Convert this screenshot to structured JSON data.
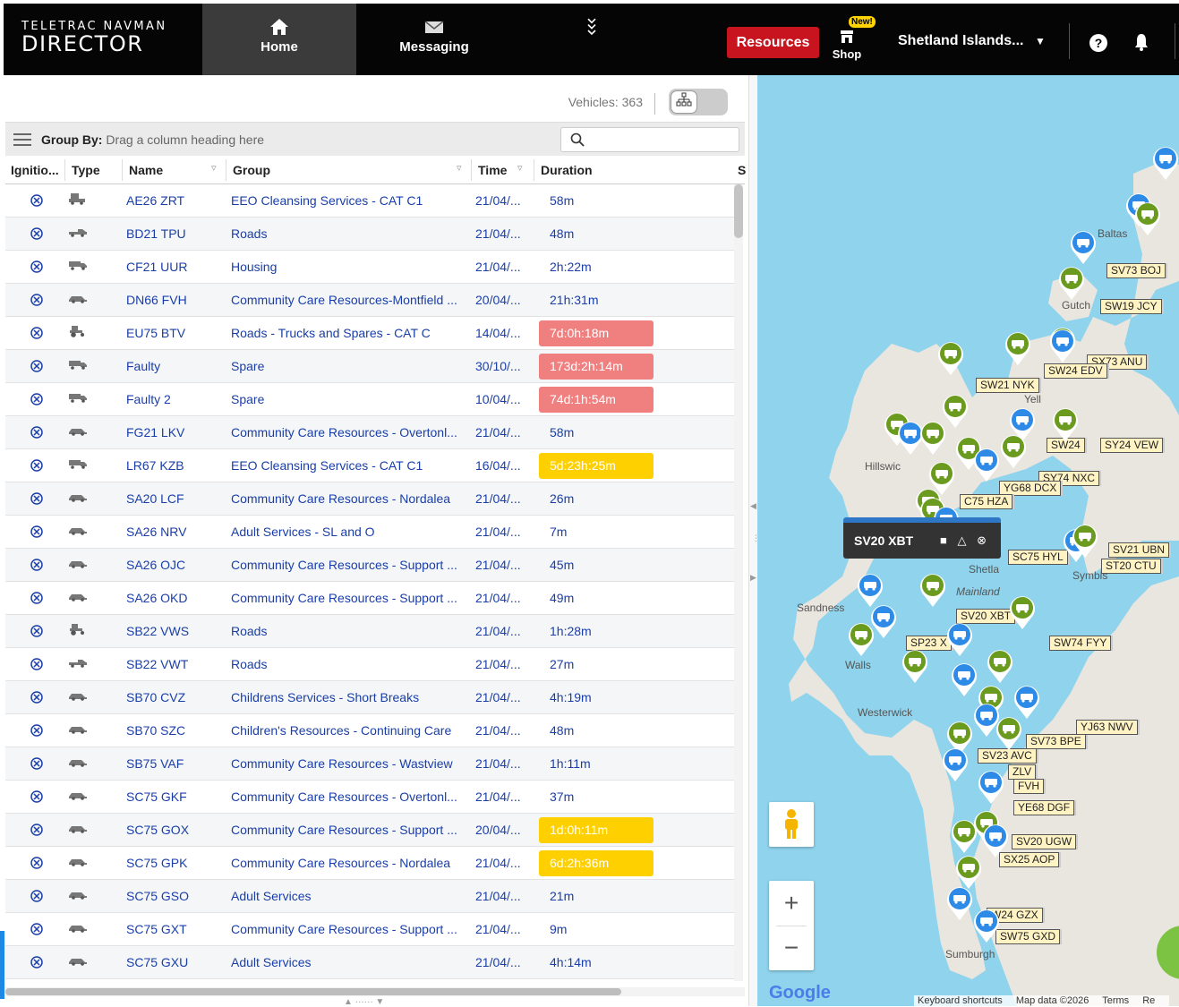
{
  "header": {
    "logo_line1": "TELETRAC NAVMAN",
    "logo_line2": "DIRECTOR",
    "nav_home": "Home",
    "nav_messaging": "Messaging",
    "resources_label": "Resources",
    "shop_badge": "New!",
    "shop_label": "Shop",
    "org_name": "Shetland Islands...",
    "accent": "#c8141e"
  },
  "toolbar": {
    "vehicles_count": "Vehicles: 363",
    "group_by_label": "Group By:",
    "group_by_hint": "Drag a column heading here"
  },
  "table": {
    "columns": [
      "Ignitio...",
      "Type",
      "Name",
      "Group",
      "Time",
      "Duration",
      "S"
    ],
    "rows": [
      {
        "name": "AE26 ZRT",
        "group": "EEO Cleansing Services - CAT C1",
        "time": "21/04/...",
        "duration": "58m",
        "dur_status": "normal",
        "type_icon": "sweeper-icon"
      },
      {
        "name": "BD21 TPU",
        "group": "Roads",
        "time": "21/04/...",
        "duration": "48m",
        "dur_status": "normal",
        "type_icon": "pickup-icon"
      },
      {
        "name": "CF21 UUR",
        "group": "Housing",
        "time": "21/04/...",
        "duration": "2h:22m",
        "dur_status": "normal",
        "type_icon": "truck-icon"
      },
      {
        "name": "DN66 FVH",
        "group": "Community Care Resources-Montfield ...",
        "time": "20/04/...",
        "duration": "21h:31m",
        "dur_status": "normal",
        "type_icon": "car-icon"
      },
      {
        "name": "EU75 BTV",
        "group": "Roads - Trucks and Spares - CAT C",
        "time": "14/04/...",
        "duration": "7d:0h:18m",
        "dur_status": "red",
        "type_icon": "tractor-icon"
      },
      {
        "name": "Faulty",
        "group": "Spare",
        "time": "30/10/...",
        "duration": "173d:2h:14m",
        "dur_status": "red",
        "type_icon": "truck-icon"
      },
      {
        "name": "Faulty 2",
        "group": "Spare",
        "time": "10/04/...",
        "duration": "74d:1h:54m",
        "dur_status": "red",
        "type_icon": "truck-icon"
      },
      {
        "name": "FG21 LKV",
        "group": "Community Care Resources - Overtonl...",
        "time": "21/04/...",
        "duration": "58m",
        "dur_status": "normal",
        "type_icon": "car-icon"
      },
      {
        "name": "LR67 KZB",
        "group": "EEO Cleansing Services - CAT C1",
        "time": "16/04/...",
        "duration": "5d:23h:25m",
        "dur_status": "yellow",
        "type_icon": "truck-icon"
      },
      {
        "name": "SA20 LCF",
        "group": "Community Care Resources - Nordalea",
        "time": "21/04/...",
        "duration": "26m",
        "dur_status": "normal",
        "type_icon": "car-icon"
      },
      {
        "name": "SA26 NRV",
        "group": "Adult Services - SL and O",
        "time": "21/04/...",
        "duration": "7m",
        "dur_status": "normal",
        "type_icon": "car-icon"
      },
      {
        "name": "SA26 OJC",
        "group": "Community Care Resources - Support ...",
        "time": "21/04/...",
        "duration": "45m",
        "dur_status": "normal",
        "type_icon": "car-icon"
      },
      {
        "name": "SA26 OKD",
        "group": "Community Care Resources - Support ...",
        "time": "21/04/...",
        "duration": "49m",
        "dur_status": "normal",
        "type_icon": "car-icon"
      },
      {
        "name": "SB22 VWS",
        "group": "Roads",
        "time": "21/04/...",
        "duration": "1h:28m",
        "dur_status": "normal",
        "type_icon": "tractor-icon"
      },
      {
        "name": "SB22 VWT",
        "group": "Roads",
        "time": "21/04/...",
        "duration": "27m",
        "dur_status": "normal",
        "type_icon": "pickup-icon"
      },
      {
        "name": "SB70 CVZ",
        "group": "Childrens Services - Short Breaks",
        "time": "21/04/...",
        "duration": "4h:19m",
        "dur_status": "normal",
        "type_icon": "car-icon"
      },
      {
        "name": "SB70 SZC",
        "group": "Children's Resources - Continuing Care",
        "time": "21/04/...",
        "duration": "48m",
        "dur_status": "normal",
        "type_icon": "car-icon"
      },
      {
        "name": "SB75 VAF",
        "group": "Community Care Resources - Wastview",
        "time": "21/04/...",
        "duration": "1h:11m",
        "dur_status": "normal",
        "type_icon": "car-icon"
      },
      {
        "name": "SC75 GKF",
        "group": "Community Care Resources - Overtonl...",
        "time": "21/04/...",
        "duration": "37m",
        "dur_status": "normal",
        "type_icon": "car-icon"
      },
      {
        "name": "SC75 GOX",
        "group": "Community Care Resources - Support ...",
        "time": "20/04/...",
        "duration": "1d:0h:11m",
        "dur_status": "yellow",
        "type_icon": "car-icon"
      },
      {
        "name": "SC75 GPK",
        "group": "Community Care Resources - Nordalea",
        "time": "21/04/...",
        "duration": "6d:2h:36m",
        "dur_status": "yellow",
        "type_icon": "car-icon"
      },
      {
        "name": "SC75 GSO",
        "group": "Adult Services",
        "time": "21/04/...",
        "duration": "21m",
        "dur_status": "normal",
        "type_icon": "car-icon"
      },
      {
        "name": "SC75 GXT",
        "group": "Community Care Resources - Support ...",
        "time": "21/04/...",
        "duration": "9m",
        "dur_status": "normal",
        "type_icon": "car-icon"
      },
      {
        "name": "SC75 GXU",
        "group": "Adult Services",
        "time": "21/04/...",
        "duration": "4h:14m",
        "dur_status": "normal",
        "type_icon": "car-icon"
      }
    ]
  },
  "map": {
    "popup_title": "SV20 XBT",
    "places": [
      "Baltas",
      "Gutch",
      "Yell",
      "Hillswic",
      "Shetla",
      "Mainland",
      "Sandness",
      "Walls",
      "Westerwick",
      "Sumburgh",
      "Symbis"
    ],
    "labels": [
      "SV73 BOJ",
      "SW19 JCY",
      "SX73 ANU",
      "SW24 EDV",
      "SW21 NYK",
      "SY24 VEW",
      "SW24",
      "SY74 NXC",
      "YG68 DCX",
      "C75 HZA",
      "SV21 UBN",
      "ST20 CTU",
      "SC75 HYL",
      "SV20 XBT",
      "SP23 X",
      "SW74 FYY",
      "SV23 AVC",
      "SV73 BPE",
      "YJ63 NWV",
      "ZLV",
      "FVH",
      "YE68 DGF",
      "SV20 UGW",
      "SX25 AOP",
      "W24 GZX",
      "SW75 GXD"
    ],
    "attribution": [
      "Keyboard shortcuts",
      "Map data ©2026",
      "Terms",
      "Re"
    ],
    "google_label": "Google"
  },
  "colors": {
    "dur_red": "#f08080",
    "dur_yellow": "#ffd000",
    "link_blue": "#1a3ea8",
    "pin_green": "#6a9a1e",
    "pin_blue": "#2d8ae6",
    "map_water": "#8fd3ec"
  }
}
